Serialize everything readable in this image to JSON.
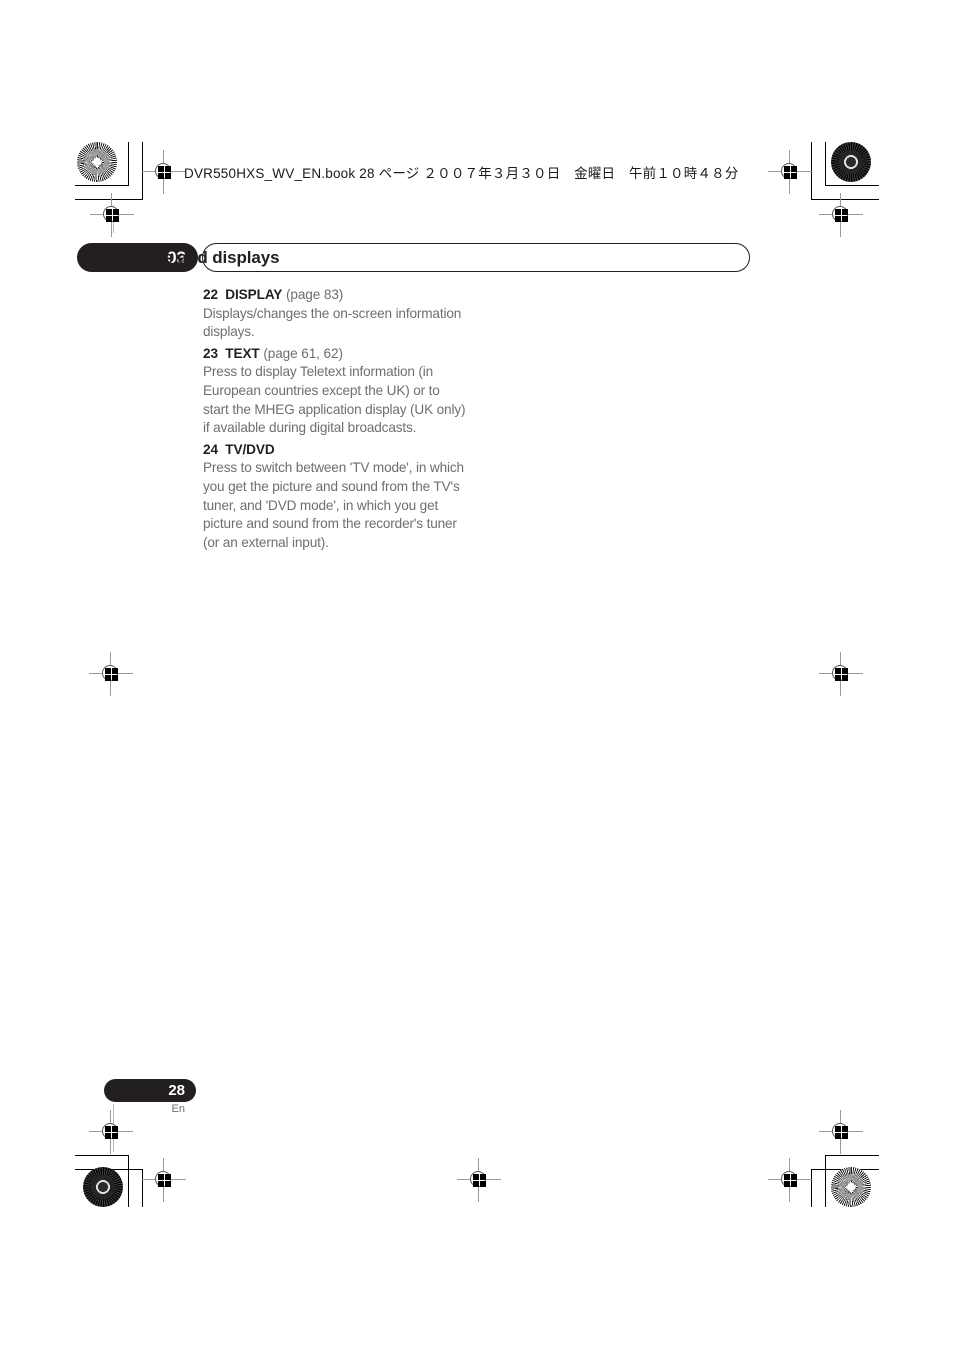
{
  "book_header": {
    "text": "DVR550HXS_WV_EN.book  28 ページ  ２００７年３月３０日　金曜日　午前１０時４８分"
  },
  "chapter": {
    "number": "03",
    "title": "Controls and displays"
  },
  "items": [
    {
      "number": "22",
      "name": "DISPLAY",
      "reference": "(page 83)",
      "description_lines": [
        "Displays/changes the on-screen information",
        "displays."
      ]
    },
    {
      "number": "23",
      "name": "TEXT",
      "reference": "(page 61, 62)",
      "description_lines": [
        "Press to display Teletext information (in",
        "European countries except the UK) or to",
        "start the MHEG application display (UK only)",
        "if available during digital broadcasts."
      ]
    },
    {
      "number": "24",
      "name": "TV/DVD",
      "reference": "",
      "description_lines": [
        "Press to switch between 'TV mode', in which",
        "you get the picture and sound from the TV's",
        "tuner, and 'DVD mode', in which you get",
        "picture and sound from the recorder's tuner",
        "(or an external input)."
      ]
    }
  ],
  "footer": {
    "page_number": "28",
    "language": "En"
  },
  "colors": {
    "ink_black": "#231f20",
    "body_gray": "#6e6e70",
    "paper": "#ffffff"
  }
}
